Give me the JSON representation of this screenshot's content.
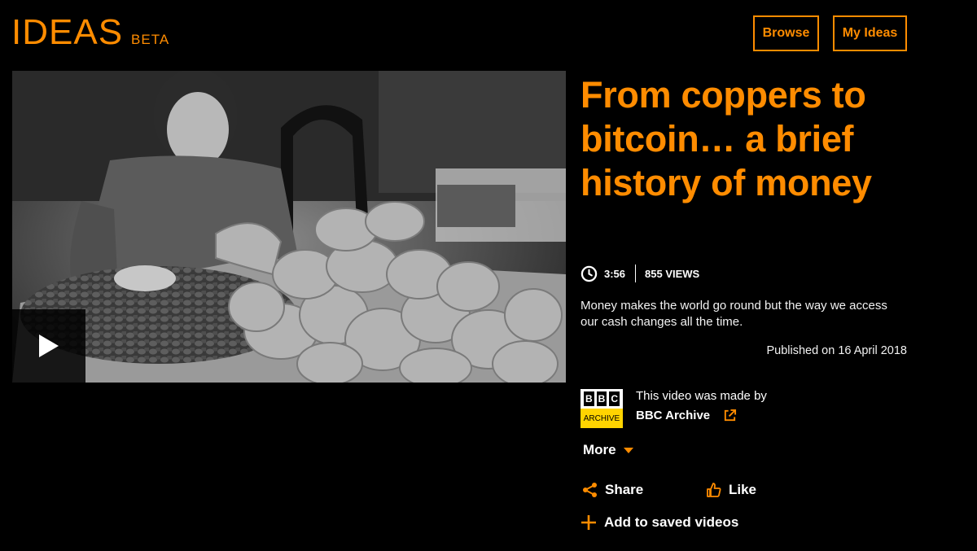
{
  "header": {
    "logo_text": "IDEAS",
    "logo_badge": "BETA",
    "nav": {
      "browse": "Browse",
      "my_ideas": "My Ideas"
    }
  },
  "video": {
    "duration": "3:56",
    "views": "855 VIEWS",
    "play_icon": "play-icon"
  },
  "article": {
    "title": "From coppers to bitcoin… a brief history of money",
    "description": "Money makes the world go round but the way we access our cash changes all the time.",
    "published": "Published on 16 April 2018"
  },
  "source": {
    "logo_letters": [
      "B",
      "B",
      "C"
    ],
    "logo_band": "ARCHIVE",
    "made_by_label": "This video was made by",
    "made_by_name": "BBC Archive"
  },
  "actions": {
    "more": "More",
    "share": "Share",
    "like": "Like",
    "save": "Add to saved videos"
  },
  "colors": {
    "accent": "#ff8c00",
    "background": "#000000",
    "archive_yellow": "#ffd400"
  }
}
